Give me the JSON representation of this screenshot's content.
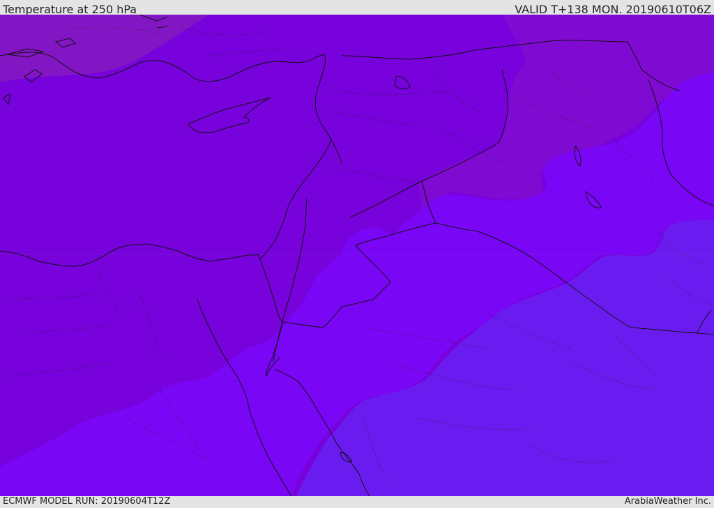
{
  "header": {
    "title": "Temperature at 250 hPa",
    "valid_time": "VALID T+138 MON. 20190610T06Z"
  },
  "footer": {
    "model_run": "ECMWF MODEL RUN: 20190604T12Z",
    "credit": "ArabiaWeather Inc."
  },
  "colors": {
    "band_coldest": "#6a1cf0",
    "band_cold": "#7a06f6",
    "band_mid": "#7702dc",
    "band_warm": "#7f0ad2",
    "band_warmest": "#8316c4",
    "background": "#e4e4e4",
    "border": "#111111"
  }
}
